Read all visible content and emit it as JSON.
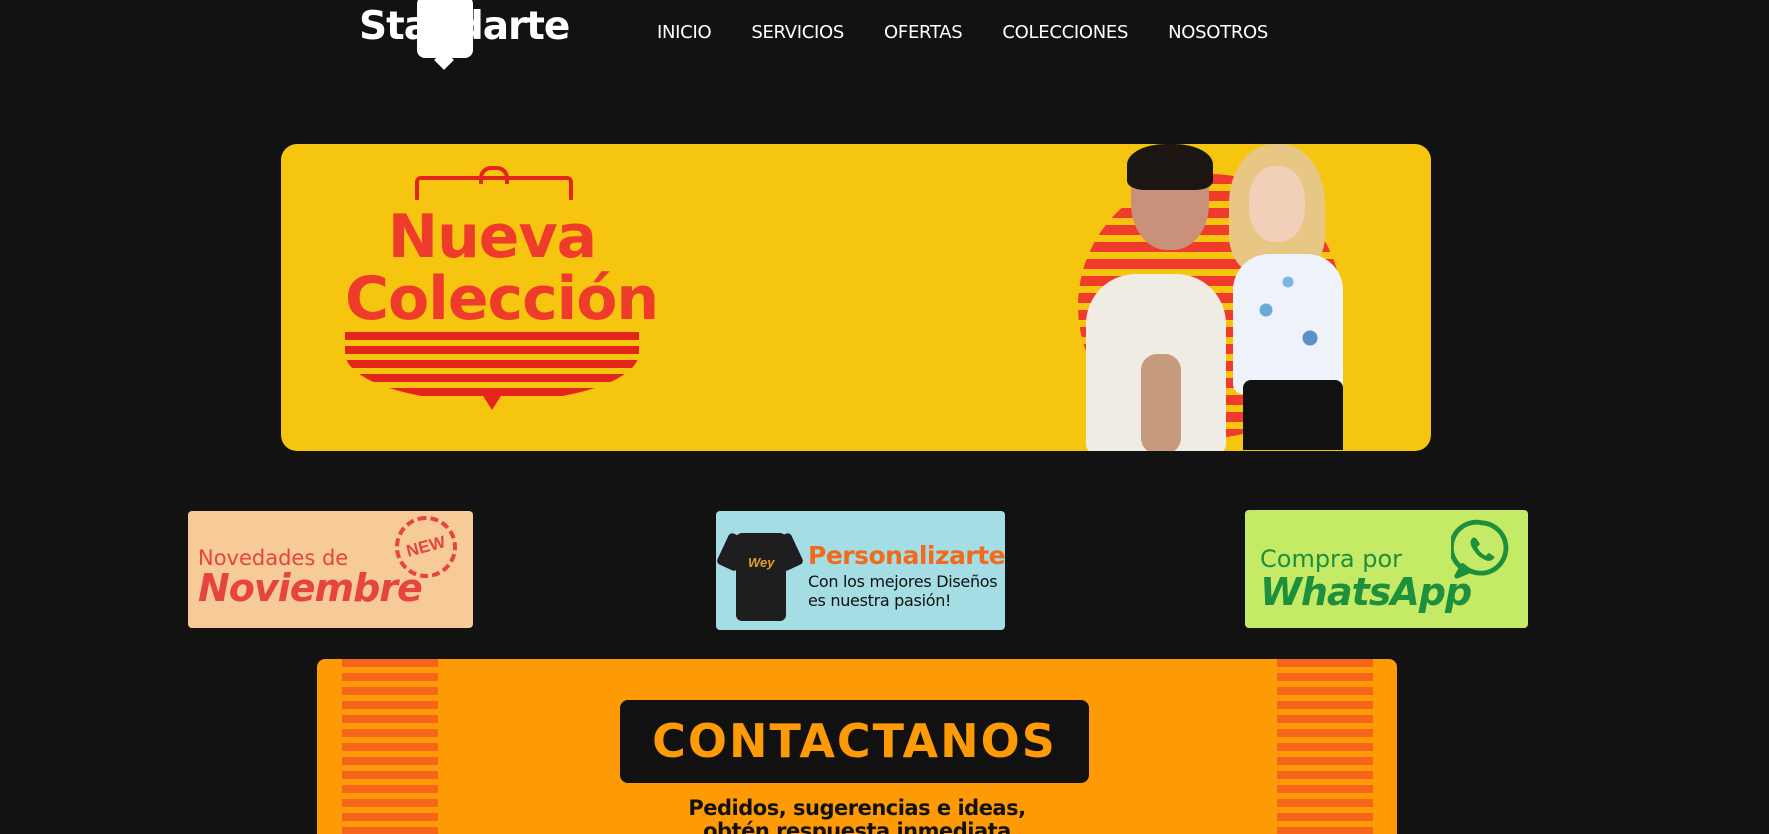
{
  "header": {
    "logo_text": "Standarte",
    "nav": [
      "INICIO",
      "SERVICIOS",
      "OFERTAS",
      "COLECCIONES",
      "NOSOTROS"
    ]
  },
  "hero": {
    "title_line1": "Nueva",
    "title_line2": "Colección"
  },
  "promos": {
    "novedades": {
      "line1": "Novedades de",
      "line2": "Noviembre",
      "badge": "NEW"
    },
    "personalizarte": {
      "shirt_print": "Wey",
      "title": "Personalizarte",
      "line1": "Con los mejores Diseños",
      "line2": "es nuestra pasión!"
    },
    "whatsapp": {
      "line1": "Compra por",
      "line2": "WhatsApp"
    }
  },
  "contact": {
    "button": "CONTACTANOS",
    "line1": "Pedidos, sugerencias e ideas,",
    "line2": "obtén respuesta inmediata"
  },
  "colors": {
    "background": "#121212",
    "hero_yellow": "#f5c50f",
    "accent_red": "#ef3b2c",
    "contact_orange": "#fe9a05",
    "whatsapp_green": "#1e8f3d"
  }
}
